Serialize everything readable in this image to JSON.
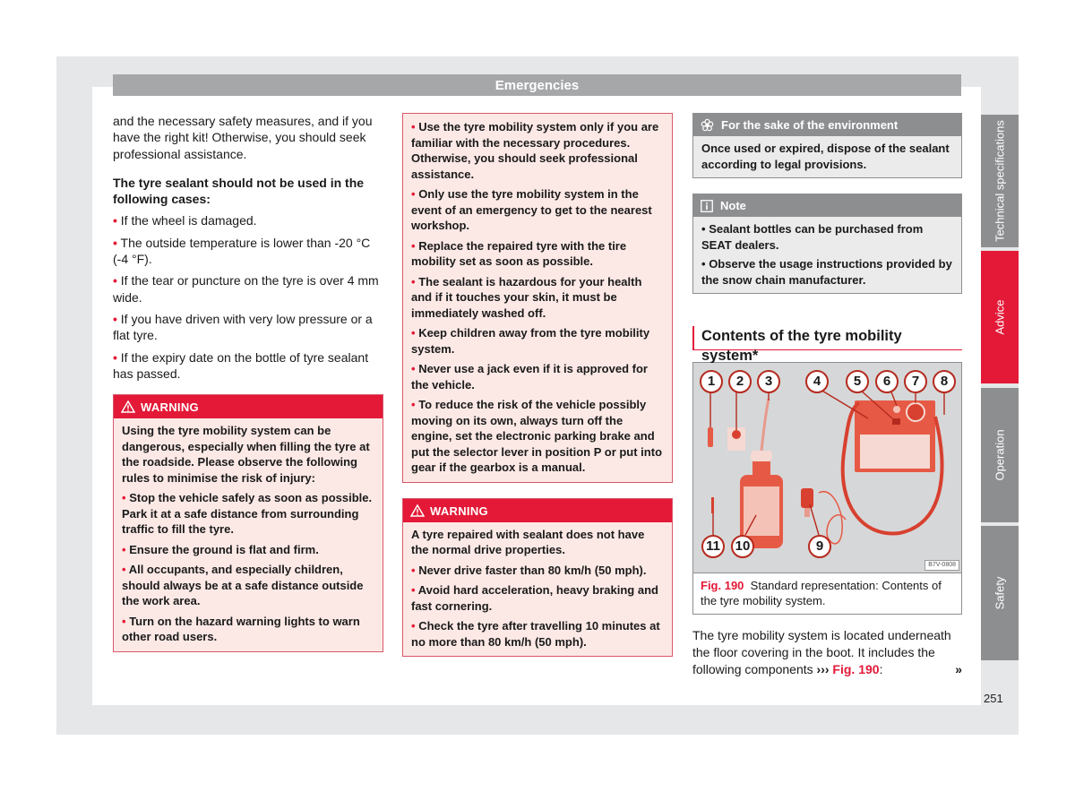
{
  "header": {
    "title": "Emergencies"
  },
  "column1": {
    "intro": "and the necessary safety measures, and if you have the right kit! Otherwise, you should seek professional assistance.",
    "heading": "The tyre sealant should not be used in the following cases:",
    "bullets": [
      "If the wheel is damaged.",
      "The outside temperature is lower than -20 °C (-4 °F).",
      "If the tear or puncture on the tyre is over 4 mm wide.",
      "If you have driven with very low pressure or a flat tyre.",
      "If the expiry date on the bottle of tyre sealant has passed."
    ],
    "warning": {
      "label": "WARNING",
      "intro": "Using the tyre mobility system can be dangerous, especially when filling the tyre at the roadside. Please observe the following rules to minimise the risk of injury:",
      "bullets": [
        "Stop the vehicle safely as soon as possible. Park it at a safe distance from surrounding traffic to fill the tyre.",
        "Ensure the ground is flat and firm.",
        "All occupants, and especially children, should always be at a safe distance outside the work area.",
        "Turn on the hazard warning lights to warn other road users."
      ]
    }
  },
  "column2": {
    "warning_continued": {
      "bullets": [
        "Use the tyre mobility system only if you are familiar with the necessary procedures. Otherwise, you should seek professional assistance.",
        "Only use the tyre mobility system in the event of an emergency to get to the nearest workshop.",
        "Replace the repaired tyre with the tire mobility set as soon as possible.",
        "The sealant is hazardous for your health and if it touches your skin, it must be immediately washed off.",
        "Keep children away from the tyre mobility system.",
        "Never use a jack even if it is approved for the vehicle.",
        "To reduce the risk of the vehicle possibly moving on its own, always turn off the engine, set the electronic parking brake and put the selector lever in position P or put into gear if the gearbox is a manual."
      ]
    },
    "warning": {
      "label": "WARNING",
      "intro": "A tyre repaired with sealant does not have the normal drive properties.",
      "bullets": [
        "Never drive faster than 80 km/h (50 mph).",
        "Avoid hard acceleration, heavy braking and fast cornering.",
        "Check the tyre after travelling 10 minutes at no more than 80 km/h (50 mph)."
      ]
    }
  },
  "column3": {
    "environment": {
      "icon": "flower-icon",
      "label": "For the sake of the environment",
      "text": "Once used or expired, dispose of the sealant according to legal provisions."
    },
    "note": {
      "icon": "info-icon",
      "label": "Note",
      "bullets": [
        "Sealant bottles can be purchased from SEAT dealers.",
        "Observe the usage instructions provided by the snow chain manufacturer."
      ]
    },
    "section_title": "Contents of the tyre mobility system*",
    "figure": {
      "callouts": [
        "1",
        "2",
        "3",
        "4",
        "5",
        "6",
        "7",
        "8",
        "9",
        "10",
        "11"
      ],
      "code": "B7V-0808",
      "caption_ref": "Fig. 190",
      "caption_text": "Standard representation: Contents of the tyre mobility system."
    },
    "after_text": "The tyre mobility system is located underneath the floor covering in the boot. It includes the following components",
    "after_arrow": "›››",
    "after_ref": "Fig. 190",
    "after_colon": ":",
    "continue_mark": "»"
  },
  "side_tabs": [
    {
      "label": "Technical specifications",
      "active": false
    },
    {
      "label": "Advice",
      "active": true
    },
    {
      "label": "Operation",
      "active": false
    },
    {
      "label": "Safety",
      "active": false
    }
  ],
  "page_number": "251",
  "colors": {
    "accent": "#e31937",
    "gray": "#8d8e90",
    "header_gray": "#a6a7a9"
  }
}
